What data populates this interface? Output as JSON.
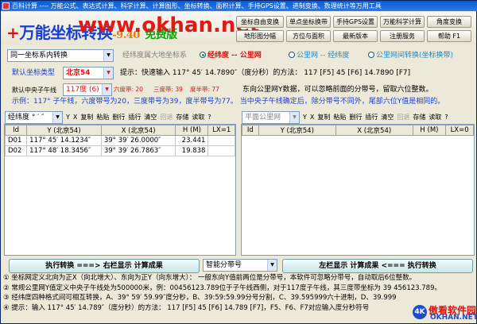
{
  "window": {
    "title": "百科计算 ---- 万能公式、表达式计算、科学计算、计算图形、坐标转换、面积计算、手持GPS设置、进制变换、数理统计等万用工具"
  },
  "header": {
    "app_title_red": "+",
    "app_title": "万能坐标转换",
    "version": "-9.40",
    "free": "免费版",
    "watermark": "www.okhan.net",
    "buttons": [
      "坐标自由变换",
      "单点坐标换带",
      "手持GPS设置",
      "万能科学计算",
      "角度变换",
      "地形图分幅",
      "方位与面积",
      "最新版本",
      "注册服务",
      "帮助 F1"
    ]
  },
  "options": {
    "mode_select": "同一坐标系内转换",
    "ellipsoid_label": "经纬度属大地坐标系",
    "radio1": "经纬度 -- 公里网",
    "radio2": "公里网 -- 经纬度",
    "radio3": "公里网间转换(坐标换带)"
  },
  "settings": {
    "default_system_label": "默认坐标类型",
    "default_system": "北京54",
    "hint_line": "提示：快速输入 117° 45′ 14.7890″（度分秒）的方法：  117  [F5]    45  [F6]    14.7890  [F7]",
    "meridian_label": "默认中央子午线",
    "meridian": "117度 (6)",
    "zone6": "六度带: 20",
    "zone3": "三度带: 39",
    "zone_deg": "度半带: 77",
    "east_hint": "东向公里网Y数据，可以忽略前面的分带号，留取六位整数。",
    "example": "示例：117° 子午线，六度带号为20，三度带号为39，度半带号为77。  当中央子午线确定后，除分带号不同外，尾部六位Y值是相同的。"
  },
  "left_pane": {
    "format": "经纬度 ° ′ ″",
    "tools": [
      "Y",
      "X",
      "复制",
      "粘贴",
      "删行",
      "插行",
      "清空",
      "回退",
      "存储",
      "读取",
      "?"
    ],
    "headers": [
      "Id",
      "Y (北京54)",
      "X (北京54)",
      "H (M)",
      "LX=1"
    ],
    "rows": [
      [
        "D01",
        "117° 45′ 14.1234″",
        "39° 39′ 26.0000″",
        "23.441",
        ""
      ],
      [
        "D02",
        "117° 48′ 18.3456″",
        "39° 39′ 26.7863″",
        "19.838",
        ""
      ]
    ]
  },
  "right_pane": {
    "format": "平面公里网",
    "tools": [
      "Y",
      "X",
      "复制",
      "粘贴",
      "删行",
      "插行",
      "清空",
      "回退",
      "存储",
      "读取",
      "?"
    ],
    "headers": [
      "Id",
      "Y (北京54)",
      "X (北京54)",
      "H (M)",
      "LX=0"
    ],
    "rows": []
  },
  "actions": {
    "run_right": "执行转换 ===> 右栏显示  计算成果",
    "zone_select": "智能分带号",
    "run_left": "左栏显示  计算成果 <=== 执行转换"
  },
  "notes": [
    "① 坐标网定义北向为正X（向北增大）、东向为正Y（向东增大）：  一般东向Y值前两位是分带号，本软件可忽略分带号，自动取后6位整数。",
    "② 常规公里网Y值定义中央子午线处为500000米，例：00456123.789位于子午线西侧，对于117度子午线，其三度带坐标为 39 456123.789。",
    "③ 经纬度四种格式间可相互转换，A、39° 59′ 59.99″度分秒，B、39:59:59.99分号分割，C、39.595999六十进制，D、39.999",
    "④ 提示：输入 117° 45′ 14.789″（度分秒）的方法：  117  [F5]  45  [F6]  14.789 [F7]，F5、F6、F7对应输入度分秒符号"
  ],
  "logo": {
    "badge": "4K",
    "cn": "傲看软件园",
    "en": "OKHAN.NET"
  }
}
